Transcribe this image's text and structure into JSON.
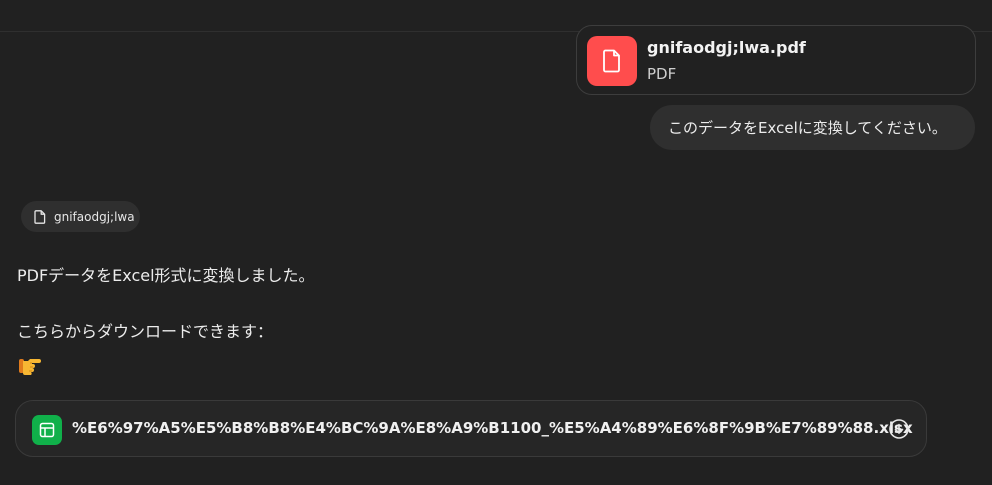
{
  "attachment": {
    "file_name": "gnifaodgj;lwa.pdf",
    "file_type": "PDF",
    "icon": "pdf-file-icon",
    "icon_color": "#ff4d4d"
  },
  "user_message": {
    "text": "このデータをExcelに変換してください。"
  },
  "assistant": {
    "source_chip": {
      "label": "gnifaodgj;lwa",
      "icon": "document-icon"
    },
    "line1": "PDFデータをExcel形式に変換しました。",
    "line2": "こちらからダウンロードできます：",
    "emoji_icon": "pointing-right-icon",
    "download": {
      "file_name": "%E6%97%A5%E5%B8%B8%E4%BC%9A%E8%A9%B1100_%E5%A4%89%E6%8F%9B%E7%89%88.xlsx",
      "icon": "spreadsheet-icon",
      "icon_color": "#10b04a",
      "action_icon": "download-icon"
    }
  },
  "colors": {
    "background": "#212121",
    "bubble": "#2f2f2f",
    "text": "#ececec"
  }
}
